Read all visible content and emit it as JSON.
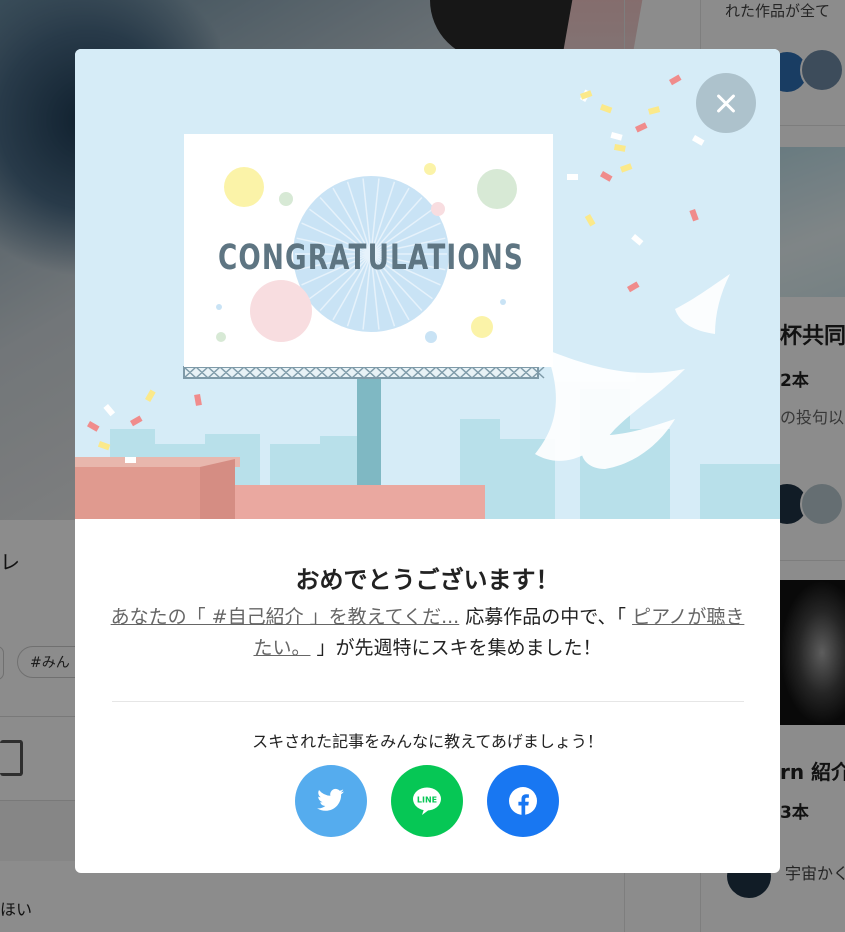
{
  "background": {
    "left_label_char": "レ",
    "tag_label": "#みん",
    "bottom_text": "ほい",
    "sidebar": {
      "top_text": "れた作品が全て",
      "card1_title": "杯共同",
      "card1_count": "2本",
      "card1_desc": "の投句以",
      "card2_title": "rn 紹介",
      "card2_count": "3本",
      "user_text": "宇宙かく"
    }
  },
  "modal": {
    "hero": {
      "billboard_text": "CONGRATULATIONS"
    },
    "close_icon": "close-icon",
    "title": "おめでとうございます！",
    "message": {
      "prefix": "あなたの「 #自己紹介 」を教えてくだ...",
      "middle": " 応募作品の中で、「 ",
      "note_title": "ピアノが聴きたい。",
      "suffix": " 」が先週特にスキを集めました！"
    },
    "share_caption": "スキされた記事をみんなに教えてあげましょう！",
    "share_buttons": [
      {
        "service": "twitter",
        "icon": "twitter-icon",
        "color": "#55acee"
      },
      {
        "service": "line",
        "icon": "line-icon",
        "label": "LINE",
        "color": "#06c755"
      },
      {
        "service": "facebook",
        "icon": "facebook-icon",
        "color": "#1877f2"
      }
    ]
  }
}
